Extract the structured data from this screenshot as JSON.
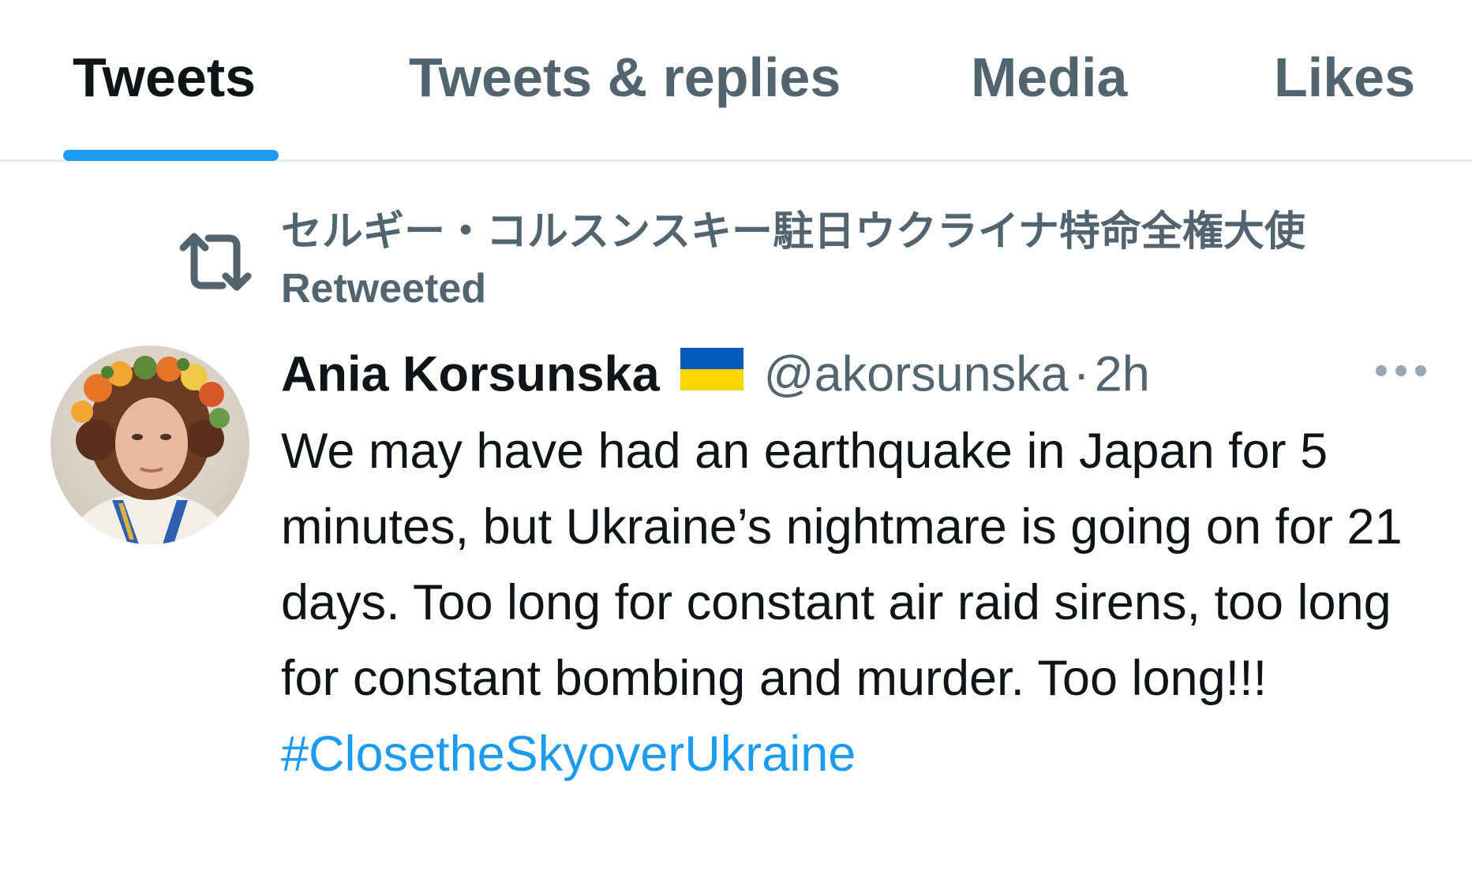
{
  "tabs": {
    "items": [
      {
        "label": "Tweets",
        "active": true
      },
      {
        "label": "Tweets & replies",
        "active": false
      },
      {
        "label": "Media",
        "active": false
      },
      {
        "label": "Likes",
        "active": false
      }
    ]
  },
  "retweet_context": {
    "icon": "retweet-icon",
    "text": "セルギー・コルスンスキー駐日ウクライナ特命全権大使 Retweeted"
  },
  "tweet": {
    "author_name": "Ania Korsunska",
    "author_flag": "ukraine-flag-icon",
    "author_handle": "@akorsunska",
    "separator": "·",
    "timestamp": "2h",
    "more_icon": "more-horizontal-icon",
    "body": "We may have had an earthquake in Japan for 5 minutes, but Ukraine’s nightmare is going on for 21 days. Too long for constant air raid sirens, too long for constant bombing and murder. Too long!!!",
    "hashtag": "#ClosetheSkyoverUkraine"
  },
  "colors": {
    "accent": "#1d9bf0",
    "text_primary": "#0f1419",
    "text_secondary": "#536471",
    "flag_blue": "#005bbb",
    "flag_yellow": "#ffd500"
  }
}
